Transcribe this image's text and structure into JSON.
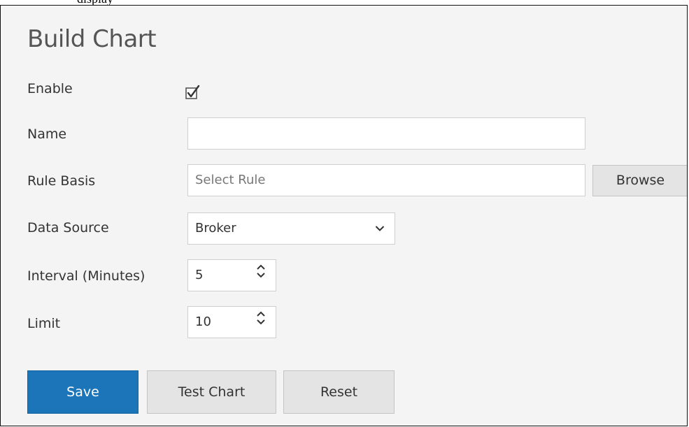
{
  "page": {
    "top_caption": "display"
  },
  "form": {
    "title": "Build Chart",
    "enable": {
      "label": "Enable",
      "checked": true,
      "icon": "checkbox-checked-icon"
    },
    "name": {
      "label": "Name",
      "value": ""
    },
    "rule_basis": {
      "label": "Rule Basis",
      "placeholder": "Select Rule",
      "browse_label": "Browse"
    },
    "data_source": {
      "label": "Data Source",
      "value": "Broker",
      "icon": "chevron-down-icon"
    },
    "interval": {
      "label": "Interval (Minutes)",
      "value": "5",
      "icon": "spinner-arrows-icon"
    },
    "limit": {
      "label": "Limit",
      "value": "10",
      "icon": "spinner-arrows-icon"
    }
  },
  "actions": {
    "save_label": "Save",
    "test_chart_label": "Test Chart",
    "reset_label": "Reset"
  },
  "colors": {
    "panel_bg": "#f4f4f4",
    "primary": "#1c75b8",
    "secondary_button": "#e4e4e4",
    "border": "#cfcfcf"
  }
}
